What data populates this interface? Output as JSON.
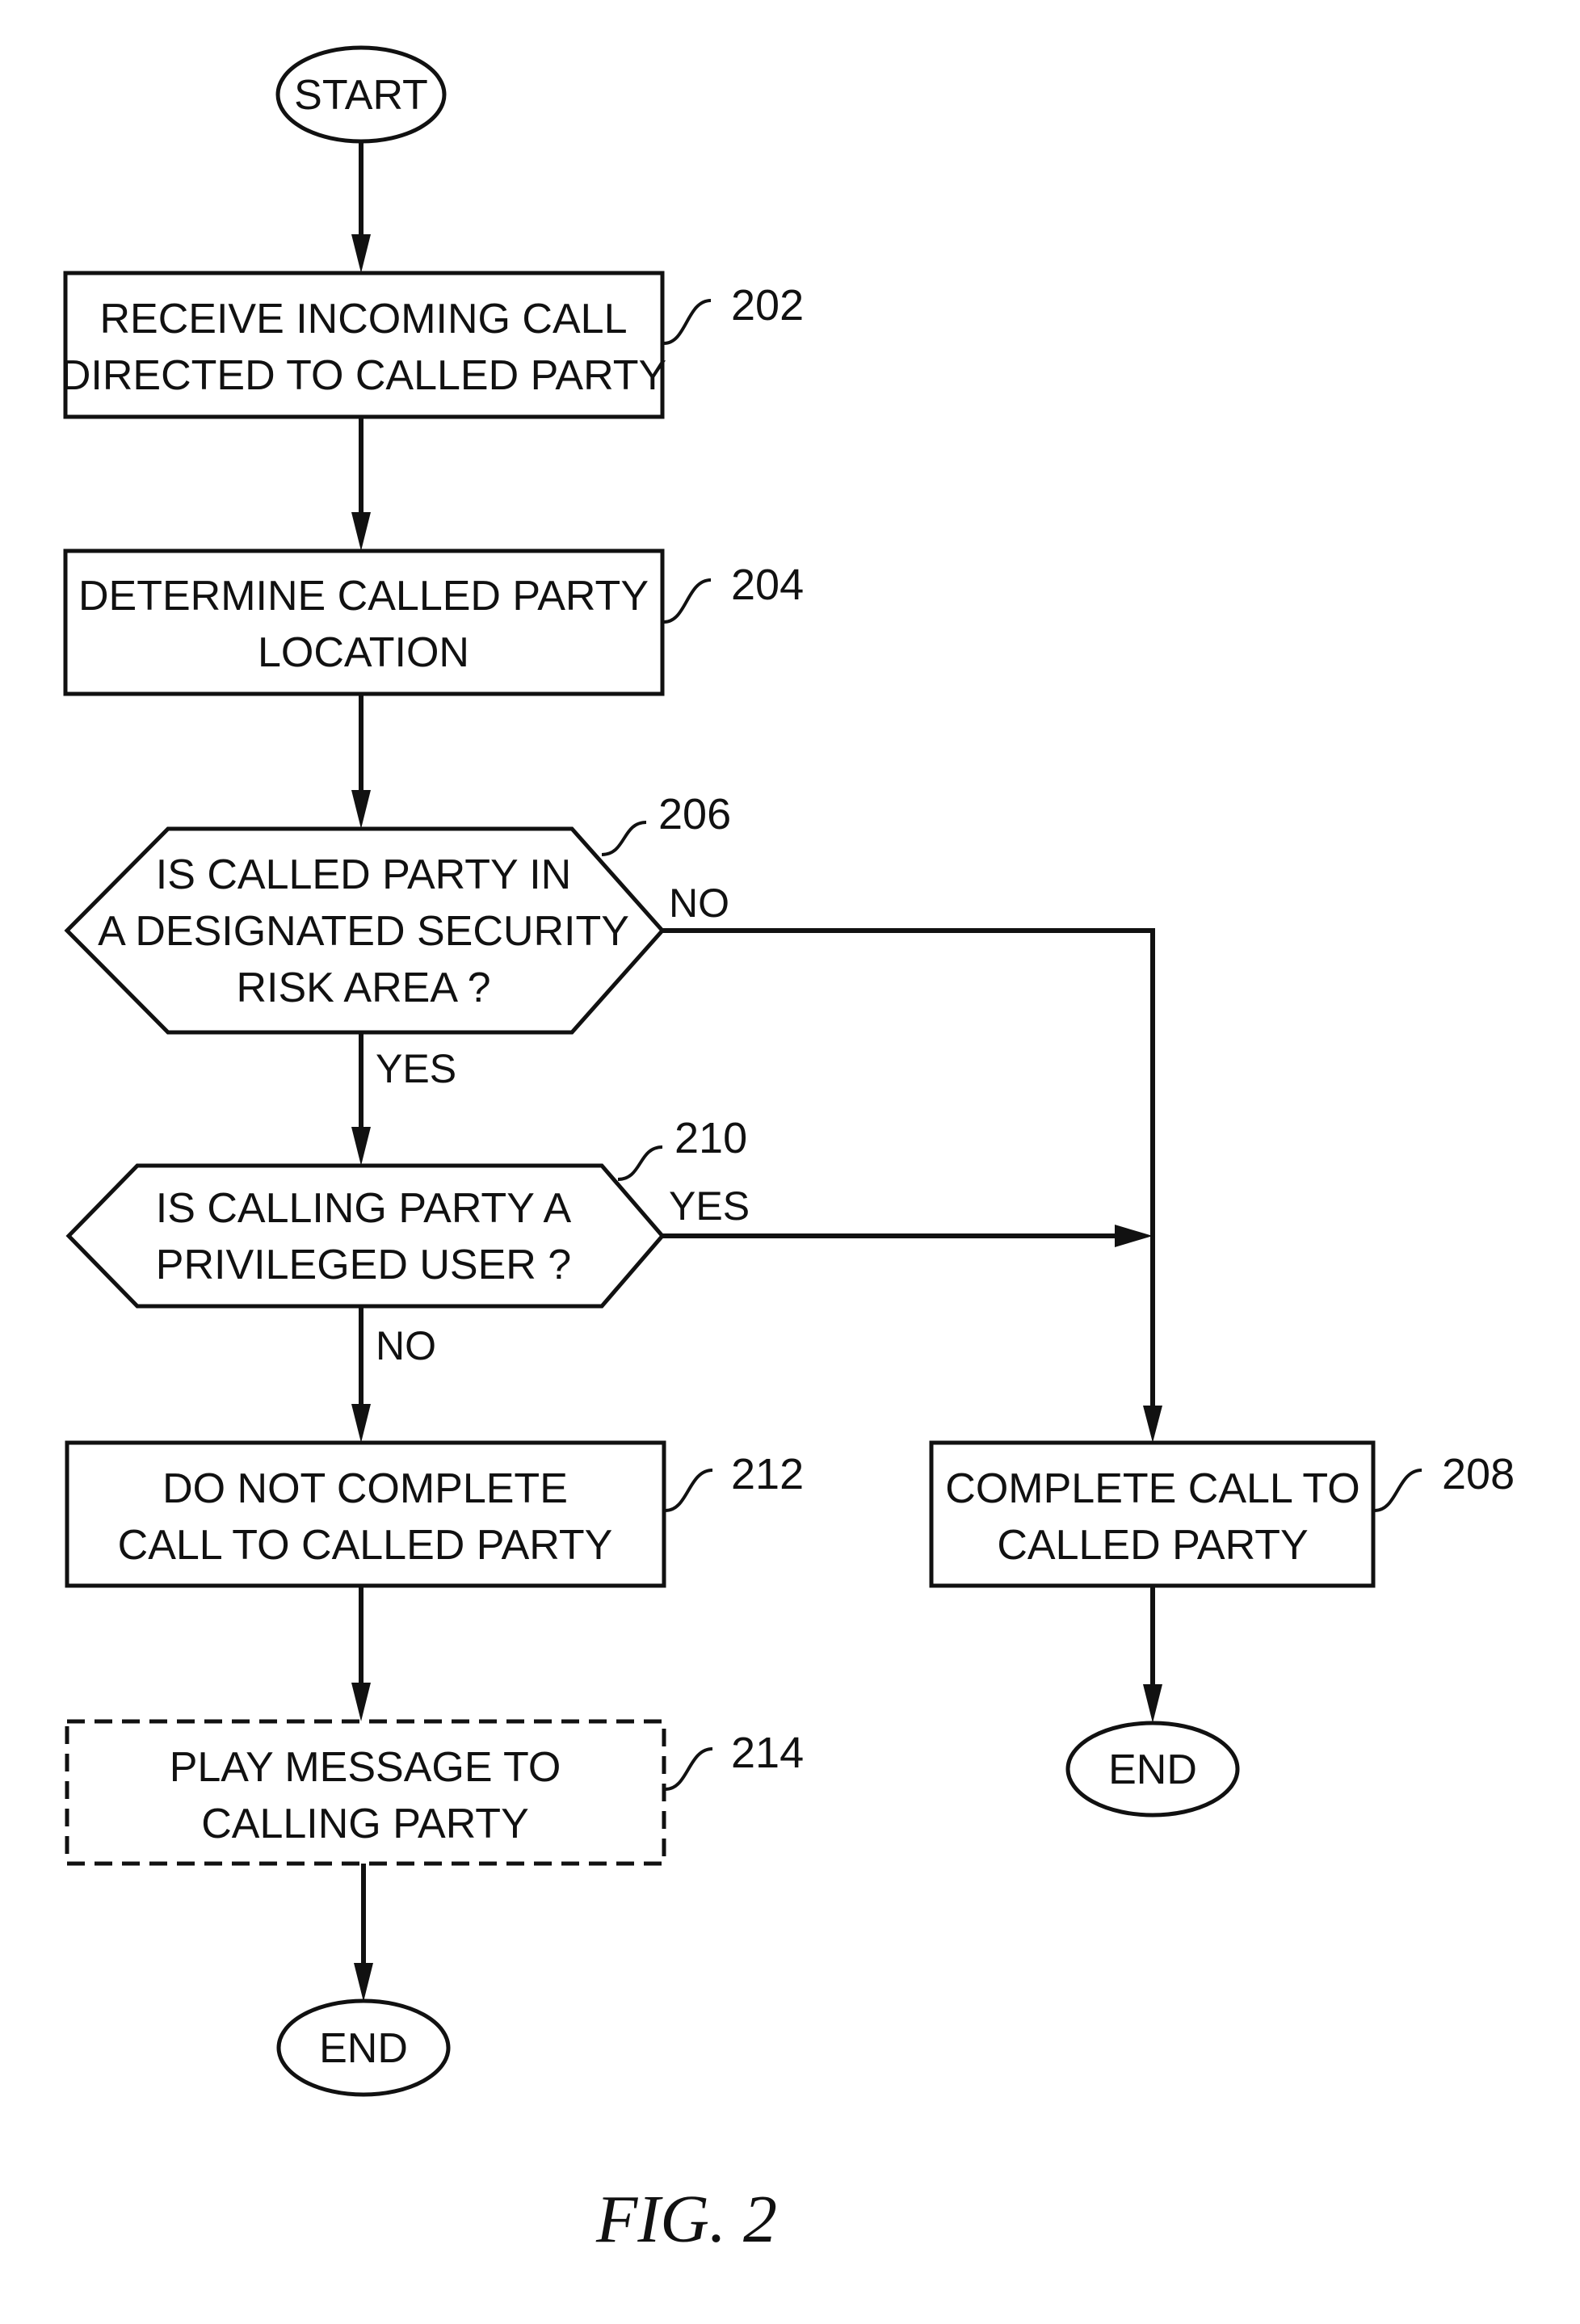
{
  "figure": {
    "caption": "FIG. 2",
    "nodes": {
      "start": {
        "shape": "terminator",
        "label": "START"
      },
      "n202": {
        "shape": "process",
        "ref": "202",
        "lines": [
          "RECEIVE INCOMING CALL",
          "DIRECTED TO CALLED PARTY"
        ]
      },
      "n204": {
        "shape": "process",
        "ref": "204",
        "lines": [
          "DETERMINE CALLED PARTY",
          "LOCATION"
        ]
      },
      "n206": {
        "shape": "decision",
        "ref": "206",
        "lines": [
          "IS CALLED PARTY IN",
          "A DESIGNATED SECURITY",
          "RISK AREA ?"
        ]
      },
      "n210": {
        "shape": "decision",
        "ref": "210",
        "lines": [
          "IS CALLING PARTY A",
          "PRIVILEGED USER ?"
        ]
      },
      "n212": {
        "shape": "process",
        "ref": "212",
        "lines": [
          "DO NOT COMPLETE",
          "CALL TO CALLED PARTY"
        ]
      },
      "n214": {
        "shape": "process-optional",
        "ref": "214",
        "lines": [
          "PLAY MESSAGE TO",
          "CALLING PARTY"
        ]
      },
      "n208": {
        "shape": "process",
        "ref": "208",
        "lines": [
          "COMPLETE CALL TO",
          "CALLED PARTY"
        ]
      },
      "end_left": {
        "shape": "terminator",
        "label": "END"
      },
      "end_right": {
        "shape": "terminator",
        "label": "END"
      }
    },
    "edges": {
      "e206_no": {
        "from": "206",
        "to": "208",
        "label": "NO"
      },
      "e206_yes": {
        "from": "206",
        "to": "210",
        "label": "YES"
      },
      "e210_yes": {
        "from": "210",
        "to": "208",
        "label": "YES"
      },
      "e210_no": {
        "from": "210",
        "to": "212",
        "label": "NO"
      }
    }
  }
}
